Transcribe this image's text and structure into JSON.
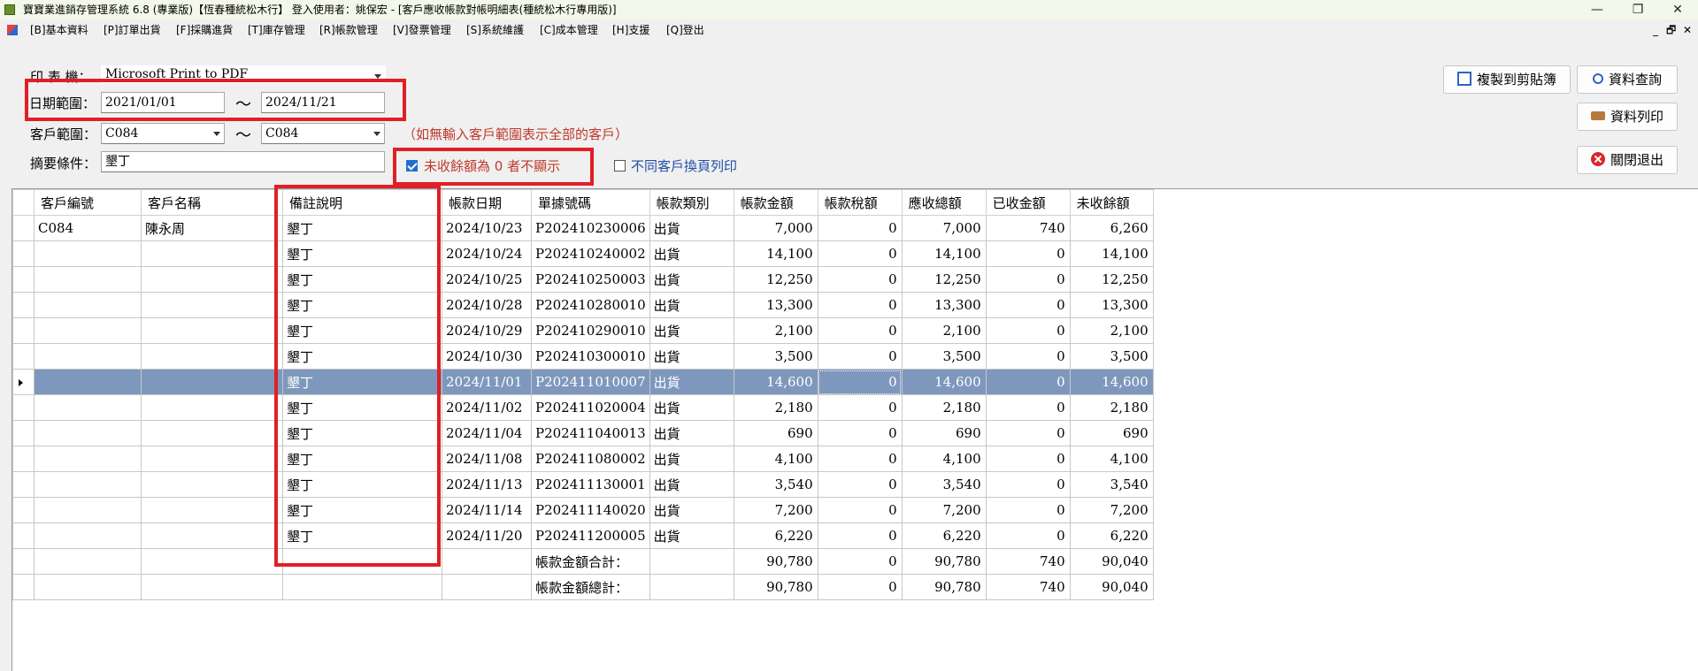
{
  "window": {
    "title": "寶寶業進銷存管理系統 6.8 (專業版)【恆春種統松木行】 登入使用者：姚保宏 - [客戶應收帳款對帳明細表(種統松木行專用版)]",
    "minimize": "—",
    "maximize": "❐",
    "close": "✕"
  },
  "menu": {
    "items": [
      "[B]基本資料",
      "[P]訂單出貨",
      "[F]採購進貨",
      "[T]庫存管理",
      "[R]帳款管理",
      "[V]發票管理",
      "[S]系統維護",
      "[C]成本管理",
      "[H]支援",
      "[Q]登出"
    ],
    "mdi_minimize": "_",
    "mdi_restore": "🗗",
    "mdi_close": "✕"
  },
  "form": {
    "printer_label": "印 表 機：",
    "printer_value": "Microsoft Print to PDF",
    "date_label": "日期範圍：",
    "date_from": "2021/01/01",
    "date_to": "2024/11/21",
    "tilde": "～",
    "customer_label": "客戶範圍：",
    "customer_from": "C084",
    "customer_to": "C084",
    "customer_hint": "（如無輸入客戶範圍表示全部的客戶）",
    "summary_label": "摘要條件：",
    "summary_value": "墾丁",
    "hide_zero_label": "未收餘額為 0 者不顯示",
    "hide_zero_checked": true,
    "page_break_label": "不同客戶換頁列印",
    "page_break_checked": false
  },
  "buttons": {
    "copy": "複製到剪貼簿",
    "query": "資料查詢",
    "print": "資料列印",
    "exit": "關閉退出"
  },
  "colors": {
    "highlight_box": "#e01f26",
    "selected_row": "#7e98bd",
    "hint_text": "#c0392b",
    "checkbox_blue": "#1f6fd1"
  },
  "grid": {
    "columns": [
      "客戶編號",
      "客戶名稱",
      "備註說明",
      "帳款日期",
      "單據號碼",
      "帳款類別",
      "帳款金額",
      "帳款稅額",
      "應收總額",
      "已收金額",
      "未收餘額"
    ],
    "rows": [
      [
        "C084",
        "陳永周",
        "墾丁",
        "2024/10/23",
        "P202410230006",
        "出貨",
        "7,000",
        "0",
        "7,000",
        "740",
        "6,260"
      ],
      [
        "",
        "",
        "墾丁",
        "2024/10/24",
        "P202410240002",
        "出貨",
        "14,100",
        "0",
        "14,100",
        "0",
        "14,100"
      ],
      [
        "",
        "",
        "墾丁",
        "2024/10/25",
        "P202410250003",
        "出貨",
        "12,250",
        "0",
        "12,250",
        "0",
        "12,250"
      ],
      [
        "",
        "",
        "墾丁",
        "2024/10/28",
        "P202410280010",
        "出貨",
        "13,300",
        "0",
        "13,300",
        "0",
        "13,300"
      ],
      [
        "",
        "",
        "墾丁",
        "2024/10/29",
        "P202410290010",
        "出貨",
        "2,100",
        "0",
        "2,100",
        "0",
        "2,100"
      ],
      [
        "",
        "",
        "墾丁",
        "2024/10/30",
        "P202410300010",
        "出貨",
        "3,500",
        "0",
        "3,500",
        "0",
        "3,500"
      ],
      [
        "",
        "",
        "墾丁",
        "2024/11/01",
        "P202411010007",
        "出貨",
        "14,600",
        "0",
        "14,600",
        "0",
        "14,600"
      ],
      [
        "",
        "",
        "墾丁",
        "2024/11/02",
        "P202411020004",
        "出貨",
        "2,180",
        "0",
        "2,180",
        "0",
        "2,180"
      ],
      [
        "",
        "",
        "墾丁",
        "2024/11/04",
        "P202411040013",
        "出貨",
        "690",
        "0",
        "690",
        "0",
        "690"
      ],
      [
        "",
        "",
        "墾丁",
        "2024/11/08",
        "P202411080002",
        "出貨",
        "4,100",
        "0",
        "4,100",
        "0",
        "4,100"
      ],
      [
        "",
        "",
        "墾丁",
        "2024/11/13",
        "P202411130001",
        "出貨",
        "3,540",
        "0",
        "3,540",
        "0",
        "3,540"
      ],
      [
        "",
        "",
        "墾丁",
        "2024/11/14",
        "P202411140020",
        "出貨",
        "7,200",
        "0",
        "7,200",
        "0",
        "7,200"
      ],
      [
        "",
        "",
        "墾丁",
        "2024/11/20",
        "P202411200005",
        "出貨",
        "6,220",
        "0",
        "6,220",
        "0",
        "6,220"
      ]
    ],
    "selected_row": 6,
    "subtotal": [
      "帳款金額合計：",
      "90,780",
      "0",
      "90,780",
      "740",
      "90,040"
    ],
    "total": [
      "帳款金額總計：",
      "90,780",
      "0",
      "90,780",
      "740",
      "90,040"
    ]
  }
}
